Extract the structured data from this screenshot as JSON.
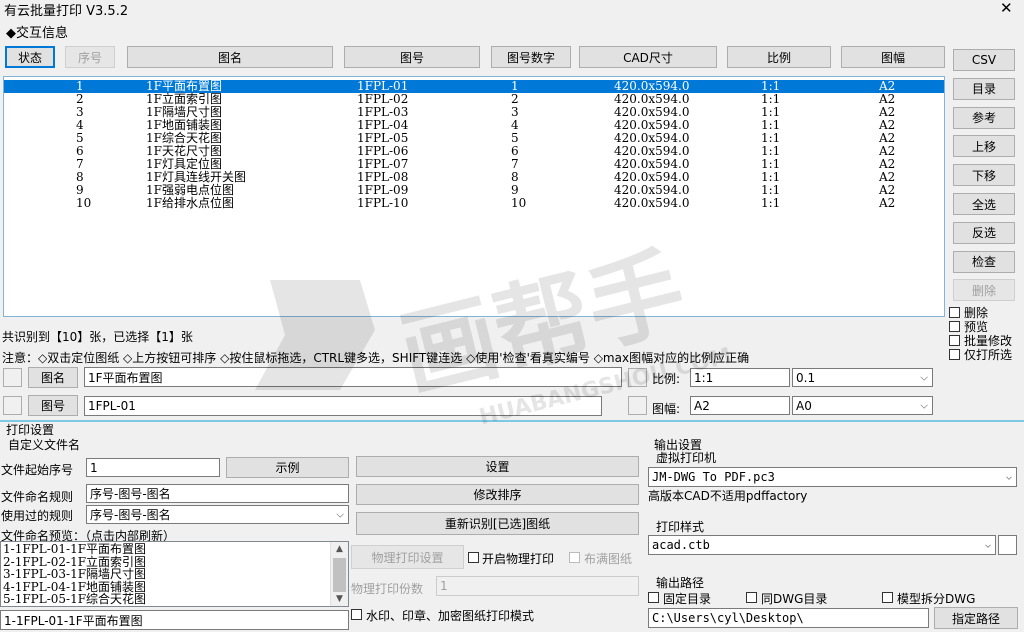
{
  "window": {
    "title": "有云批量打印 V3.5.2",
    "close_glyph": "✕"
  },
  "interaction": {
    "group_label": "◆交互信息",
    "columns": [
      "状态",
      "序号",
      "图名",
      "图号",
      "图号数字",
      "CAD尺寸",
      "比例",
      "图幅"
    ],
    "rows": [
      {
        "seq": "1",
        "name": "1F平面布置图",
        "code": "1FPL-01",
        "num": "1",
        "size": "420.0x594.0",
        "scale": "1:1",
        "format": "A2"
      },
      {
        "seq": "2",
        "name": "1F立面索引图",
        "code": "1FPL-02",
        "num": "2",
        "size": "420.0x594.0",
        "scale": "1:1",
        "format": "A2"
      },
      {
        "seq": "3",
        "name": "1F隔墙尺寸图",
        "code": "1FPL-03",
        "num": "3",
        "size": "420.0x594.0",
        "scale": "1:1",
        "format": "A2"
      },
      {
        "seq": "4",
        "name": "1F地面铺装图",
        "code": "1FPL-04",
        "num": "4",
        "size": "420.0x594.0",
        "scale": "1:1",
        "format": "A2"
      },
      {
        "seq": "5",
        "name": "1F综合天花图",
        "code": "1FPL-05",
        "num": "5",
        "size": "420.0x594.0",
        "scale": "1:1",
        "format": "A2"
      },
      {
        "seq": "6",
        "name": "1F天花尺寸图",
        "code": "1FPL-06",
        "num": "6",
        "size": "420.0x594.0",
        "scale": "1:1",
        "format": "A2"
      },
      {
        "seq": "7",
        "name": "1F灯具定位图",
        "code": "1FPL-07",
        "num": "7",
        "size": "420.0x594.0",
        "scale": "1:1",
        "format": "A2"
      },
      {
        "seq": "8",
        "name": "1F灯具连线开关图",
        "code": "1FPL-08",
        "num": "8",
        "size": "420.0x594.0",
        "scale": "1:1",
        "format": "A2"
      },
      {
        "seq": "9",
        "name": "1F强弱电点位图",
        "code": "1FPL-09",
        "num": "9",
        "size": "420.0x594.0",
        "scale": "1:1",
        "format": "A2"
      },
      {
        "seq": "10",
        "name": "1F给排水点位图",
        "code": "1FPL-10",
        "num": "10",
        "size": "420.0x594.0",
        "scale": "1:1",
        "format": "A2"
      }
    ],
    "side_buttons": [
      "CSV",
      "目录",
      "参考",
      "上移",
      "下移",
      "全选",
      "反选",
      "检查",
      "删除"
    ],
    "side_checks": [
      "删除",
      "预览",
      "批量修改",
      "仅打所选"
    ],
    "summary": "共识别到【10】张，已选择【1】张",
    "note": "注意：◇双击定位图纸 ◇上方按钮可排序 ◇按住鼠标拖选，CTRL键多选，SHIFT键连选 ◇使用'检查'看真实编号 ◇max图幅对应的比例应正确",
    "name_label": "图名",
    "name_value": "1F平面布置图",
    "code_label": "图号",
    "code_value": "1FPL-01",
    "scale_label": "比例:",
    "scale_value": "1:1",
    "scale_option": "0.1",
    "format_label": "图幅:",
    "format_value": "A2",
    "format_option": "A0"
  },
  "print": {
    "group_label": "打印设置",
    "custom_name_label": "自定义文件名",
    "start_seq_label": "文件起始序号",
    "start_seq_value": "1",
    "example_btn": "示例",
    "naming_rule_label": "文件命名规则",
    "naming_rule_value": "序号-图号-图名",
    "used_rule_label": "使用过的规则",
    "used_rule_value": "序号-图号-图名",
    "preview_label": "文件命名预览：（点击内部刷新）",
    "preview_lines": [
      "1-1FPL-01-1F平面布置图",
      "2-1FPL-02-1F立面索引图",
      "3-1FPL-03-1F隔墙尺寸图",
      "4-1FPL-04-1F地面铺装图",
      "5-1FPL-05-1F综合天花图"
    ],
    "current_name": "1-1FPL-01-1F平面布置图",
    "settings_btn": "设置",
    "reorder_btn": "修改排序",
    "reidentify_btn": "重新识别[已选]图纸",
    "physical_settings_btn": "物理打印设置",
    "physical_enable": "开启物理打印",
    "fill_page": "布满图纸",
    "physical_copies_label": "物理打印份数",
    "physical_copies_value": "1",
    "watermark_check": "水印、印章、加密图纸打印模式"
  },
  "output": {
    "group_label": "输出设置",
    "virtual_printer_label": "虚拟打印机",
    "virtual_printer_value": "JM-DWG To PDF.pc3",
    "note": "高版本CAD不适用pdffactory",
    "style_label": "打印样式",
    "style_value": "acad.ctb",
    "path_label": "输出路径",
    "fixed_dir": "固定目录",
    "same_dwg_dir": "同DWG目录",
    "model_split": "模型拆分DWG",
    "path_value": "C:\\Users\\cyl\\Desktop\\",
    "specify_btn": "指定路径"
  },
  "watermark": {
    "brand": "画帮手",
    "url": "HUABANGSHOU.COM"
  }
}
